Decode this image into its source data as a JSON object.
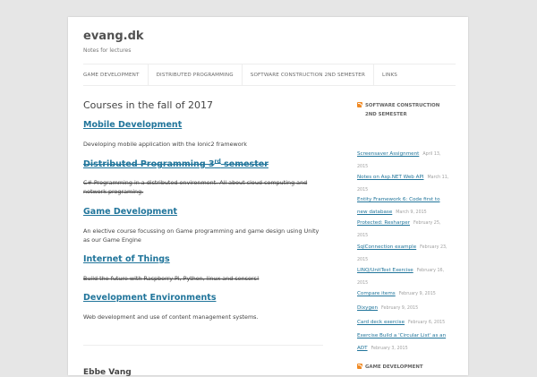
{
  "site": {
    "title": "evang.dk",
    "description": "Notes for lectures"
  },
  "nav": {
    "items": [
      "GAME DEVELOPMENT",
      "DISTRIBUTED PROGRAMMING",
      "SOFTWARE CONSTRUCTION 2ND SEMESTER",
      "LINKS"
    ]
  },
  "main": {
    "page_title": "Courses in the fall of 2017",
    "courses": [
      {
        "title": "Mobile Development",
        "description": "Developing mobile application with the Ionic2 framework"
      },
      {
        "title": "Distributed Programming 3",
        "title_sup": "rd",
        "title_suffix": " semester",
        "description": "C# Programming  in a distributed environment. All about cloud computing and network programing."
      },
      {
        "title": "Game Development ",
        "description": "An elective course focussing on Game programming and game design using Unity as our Game Engine"
      },
      {
        "title": "Internet of Things",
        "description": "Build the future with Raspberry Pi, Python, linux and sensors!"
      },
      {
        "title": "Development Environments",
        "description": "Web development and use of content management systems."
      }
    ],
    "author": "Ebbe Vang"
  },
  "sidebar": {
    "widget1_title": "SOFTWARE CONSTRUCTION 2ND SEMESTER",
    "widget1_items": [
      {
        "title": "Screensaver Assignment",
        "date": "April 13, 2015"
      },
      {
        "title": "Notes on Asp.NET Web API",
        "date": "March 11, 2015"
      },
      {
        "title": "Entity Framework 6: Code first to new database",
        "date": "March 9, 2015"
      },
      {
        "title": "Protected: Resharper",
        "date": "February 25, 2015"
      },
      {
        "title": "SqlConnection example",
        "date": "February 23, 2015"
      },
      {
        "title": "LINQ/UnitTest Exercise",
        "date": "February 16, 2015"
      },
      {
        "title": "Compare items",
        "date": "February 9, 2015"
      },
      {
        "title": "Dixygen",
        "date": "February 9, 2015"
      },
      {
        "title": "Card deck exercise",
        "date": "February 6, 2015"
      },
      {
        "title": "Exercise Build a 'Circular List' as an ADT",
        "date": "February 3, 2015"
      }
    ],
    "widget2_title": "GAME DEVELOPMENT"
  },
  "colors": {
    "link": "#21759b",
    "background": "#e6e6e6",
    "rss": "#f08a24"
  }
}
